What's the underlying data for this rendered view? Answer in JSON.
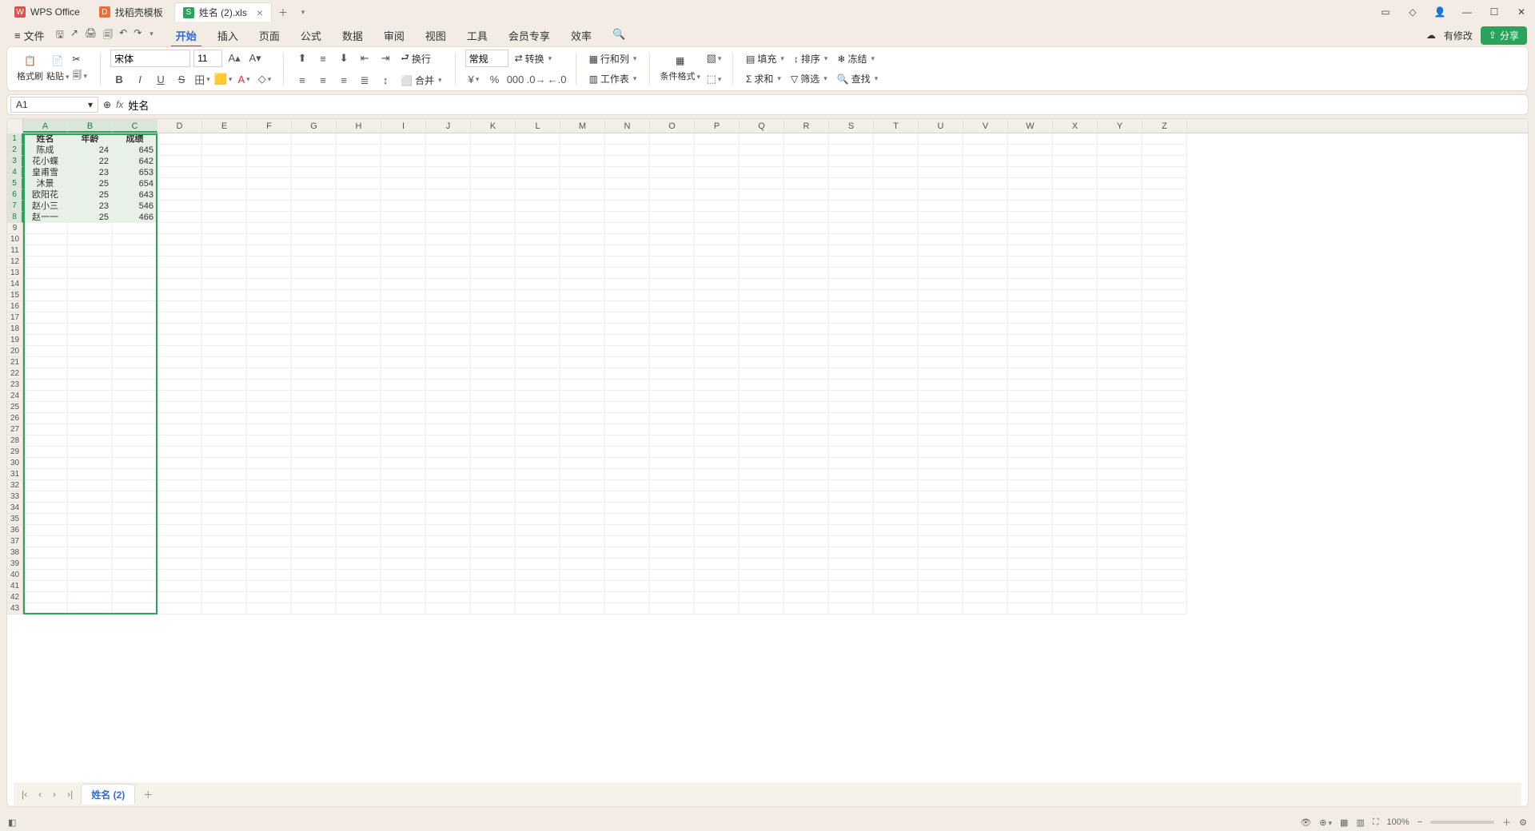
{
  "titlebar": {
    "app_tab": "WPS Office",
    "template_tab": "找稻壳模板",
    "file_tab": "姓名 (2).xls"
  },
  "menubar": {
    "file": "文件",
    "tabs": [
      "开始",
      "插入",
      "页面",
      "公式",
      "数据",
      "审阅",
      "视图",
      "工具",
      "会员专享",
      "效率"
    ],
    "modified": "有修改",
    "share": "分享"
  },
  "ribbon": {
    "format_painter": "格式刷",
    "paste": "粘贴",
    "font_name": "宋体",
    "font_size": "11",
    "wrap": "换行",
    "merge": "合并",
    "number_format": "常规",
    "convert": "转换",
    "row_col": "行和列",
    "worksheet": "工作表",
    "cond_format": "条件格式",
    "fill": "填充",
    "sort": "排序",
    "freeze": "冻结",
    "sum": "求和",
    "filter": "筛选",
    "find": "查找"
  },
  "formula": {
    "cell_ref": "A1",
    "value": "姓名"
  },
  "columns": [
    "A",
    "B",
    "C",
    "D",
    "E",
    "F",
    "G",
    "H",
    "I",
    "J",
    "K",
    "L",
    "M",
    "N",
    "O",
    "P",
    "Q",
    "R",
    "S",
    "T",
    "U",
    "V",
    "W",
    "X",
    "Y",
    "Z"
  ],
  "selected_cols": 3,
  "data": {
    "headers": [
      "姓名",
      "年龄",
      "成绩"
    ],
    "rows": [
      [
        "陈成",
        "24",
        "645"
      ],
      [
        "花小蝶",
        "22",
        "642"
      ],
      [
        "皇甫雪",
        "23",
        "653"
      ],
      [
        "沐景",
        "25",
        "654"
      ],
      [
        "欧阳花",
        "25",
        "643"
      ],
      [
        "赵小三",
        "23",
        "546"
      ],
      [
        "赵一一",
        "25",
        "466"
      ]
    ]
  },
  "sheet": {
    "name": "姓名 (2)"
  },
  "status": {
    "zoom": "100%"
  }
}
